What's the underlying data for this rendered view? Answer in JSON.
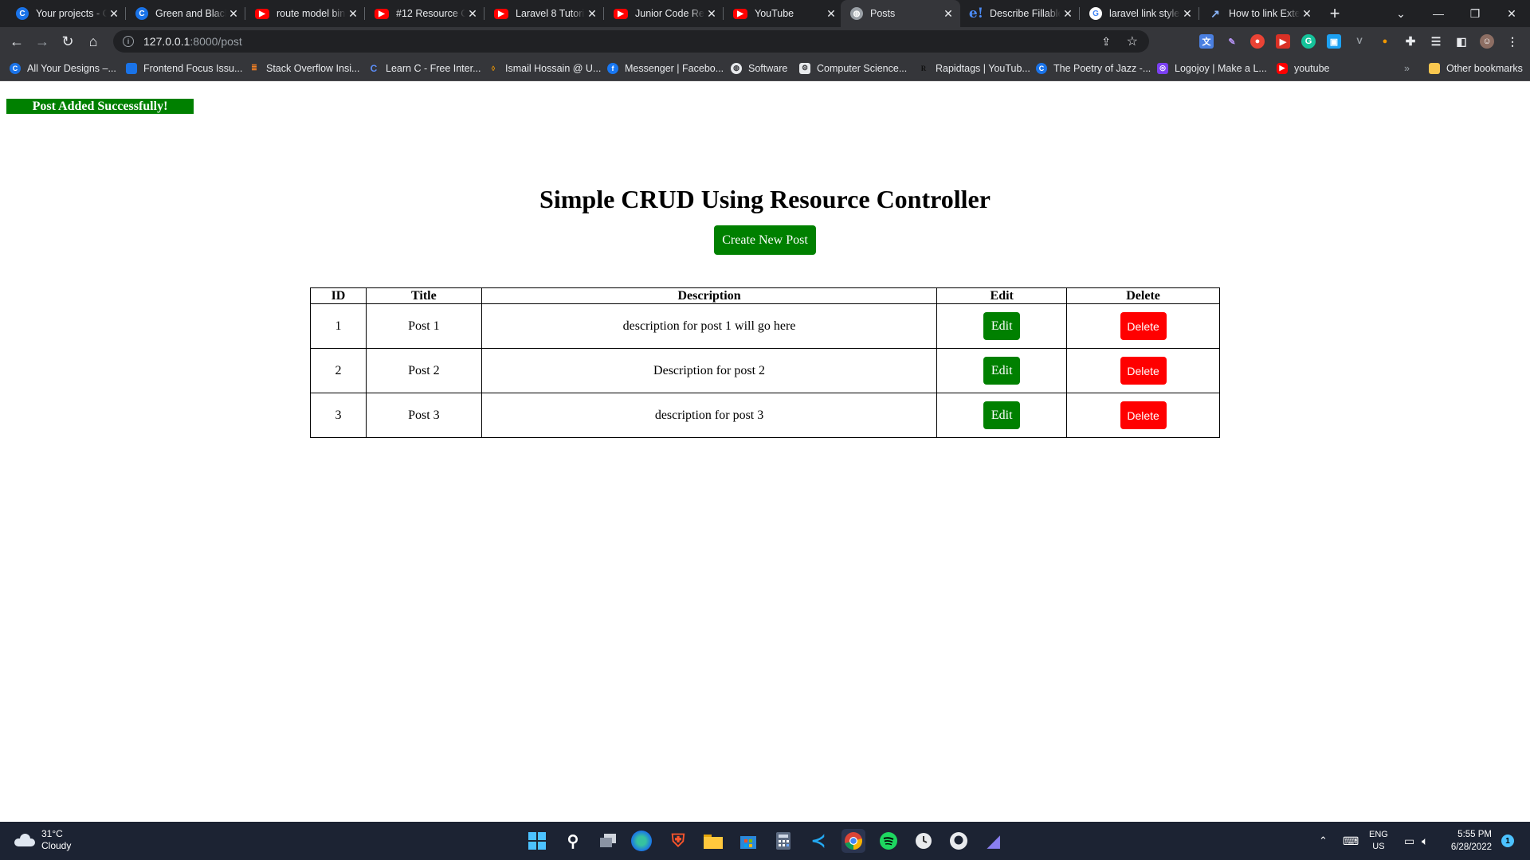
{
  "browser": {
    "tabs": [
      {
        "title": "Your projects - C",
        "icon": "canva-icon"
      },
      {
        "title": "Green and Black",
        "icon": "canva-icon"
      },
      {
        "title": "route model bin",
        "icon": "youtube-icon"
      },
      {
        "title": "#12 Resource C",
        "icon": "youtube-icon"
      },
      {
        "title": "Laravel 8 Tutori",
        "icon": "youtube-icon"
      },
      {
        "title": "Junior Code Re",
        "icon": "youtube-icon"
      },
      {
        "title": "YouTube",
        "icon": "youtube-icon"
      },
      {
        "title": "Posts",
        "icon": "globe-icon",
        "active": true
      },
      {
        "title": "Describe Fillable",
        "icon": "e-icon"
      },
      {
        "title": "laravel link style",
        "icon": "google-icon"
      },
      {
        "title": "How to link Exte",
        "icon": "arrow-icon"
      }
    ],
    "url_host": "127.0.0.1",
    "url_rest": ":8000/post",
    "bookmarks": [
      {
        "label": "All Your Designs –..."
      },
      {
        "label": "Frontend Focus Issu..."
      },
      {
        "label": "Stack Overflow Insi..."
      },
      {
        "label": "Learn C - Free Inter..."
      },
      {
        "label": "Ismail Hossain @ U..."
      },
      {
        "label": "Messenger | Facebo..."
      },
      {
        "label": "Software"
      },
      {
        "label": "Computer Science..."
      },
      {
        "label": "Rapidtags | YouTub..."
      },
      {
        "label": "The Poetry of Jazz -..."
      },
      {
        "label": "Logojoy | Make a L..."
      },
      {
        "label": "youtube"
      }
    ],
    "bookmarks_overflow": "»",
    "other_bookmarks": "Other bookmarks"
  },
  "page": {
    "flash_message": "Post Added Successfully!",
    "heading": "Simple CRUD Using Resource Controller",
    "create_button": "Create New Post",
    "table": {
      "headers": [
        "ID",
        "Title",
        "Description",
        "Edit",
        "Delete"
      ],
      "rows": [
        {
          "id": "1",
          "title": "Post 1",
          "description": "description for post 1 will go here",
          "edit": "Edit",
          "delete": "Delete"
        },
        {
          "id": "2",
          "title": "Post 2",
          "description": "Description for post 2",
          "edit": "Edit",
          "delete": "Delete"
        },
        {
          "id": "3",
          "title": "Post 3",
          "description": "description for post 3",
          "edit": "Edit",
          "delete": "Delete"
        }
      ]
    }
  },
  "taskbar": {
    "temperature": "31°C",
    "weather": "Cloudy",
    "language": "ENG",
    "region": "US",
    "time": "5:55 PM",
    "date": "6/28/2022",
    "notification_count": "1"
  },
  "colors": {
    "success_green": "#008000",
    "danger_red": "#ff0000",
    "chrome_dark": "#202124",
    "taskbar": "#1c2333"
  }
}
